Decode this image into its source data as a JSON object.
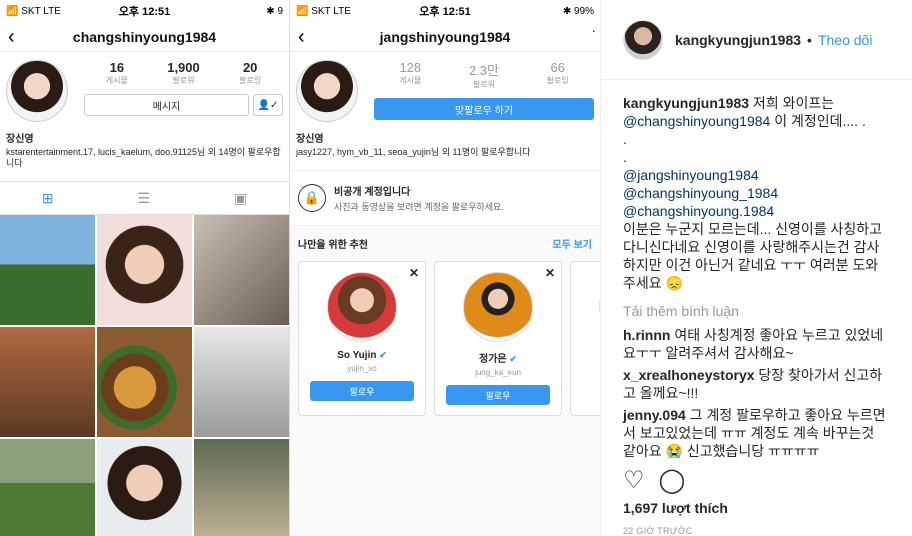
{
  "phone1": {
    "status": {
      "carrier": "📶 SKT  LTE",
      "time": "오후 12:51",
      "battery": "✱ 9"
    },
    "username": "changshinyoung1984",
    "stats": [
      {
        "num": "16",
        "label": "게시물"
      },
      {
        "num": "1,900",
        "label": "팔로워"
      },
      {
        "num": "20",
        "label": "팔로잉"
      }
    ],
    "message_btn": "메시지",
    "name": "장신영",
    "followed_by": "kstarentertainment.17, lucis_kaelum, doo.91125님 외 14명이 팔로우합니다"
  },
  "phone2": {
    "status": {
      "carrier": "📶 SKT  LTE",
      "time": "오후 12:51",
      "battery": "✱ 99%"
    },
    "username": "jangshinyoung1984",
    "stats": [
      {
        "num": "128",
        "label": "게시물"
      },
      {
        "num": "2.3만",
        "label": "팔로워"
      },
      {
        "num": "66",
        "label": "팔로잉"
      }
    ],
    "follow_back_btn": "맞팔로우 하기",
    "name": "장신영",
    "followed_by": "jasy1227, hym_vb_11, seoa_yujin님 외 11명이 팔로우합니다",
    "private_title": "비공개 계정입니다",
    "private_sub": "사진과 동영상을 보려면 계정을 팔로우하세요.",
    "suggest_title": "나만을 위한 추천",
    "suggest_all": "모두 보기",
    "suggestions": [
      {
        "name": "So Yujin",
        "handle": "yujin_so",
        "button": "팔로우"
      },
      {
        "name": "정가은",
        "handle": "jung_ka_eun",
        "button": "팔로우"
      }
    ]
  },
  "side": {
    "username": "kangkyungjun1983",
    "separator": "•",
    "follow": "Theo dõi",
    "caption_user": "kangkyungjun1983",
    "caption_line1": " 저희 와이프는",
    "caption_mention": "@changshinyoung1984",
    "caption_line2": " 이 계정인데.... .",
    "dot1": ".",
    "dot2": ".",
    "mention1": "@jangshinyoung1984",
    "mention2": "@changshinyoung_1984",
    "mention3": "@changshinyoung.1984",
    "caption_tail": "이분은 누군지 모르는데... 신영이를 사칭하고 다니신다네요 신영이를 사랑해주시는건 감사하지만 이건 아닌거 같네요 ㅜㅜ 여러분 도와주세요 😞",
    "load_more": "Tải thêm bình luận",
    "comments": [
      {
        "user": "h.rinnn",
        "text": " 여태 사칭계정 좋아요 누르고 있었네요ㅜㅜ 알려주셔서 감사해요~"
      },
      {
        "user": "x_xrealhoneystoryx",
        "text": " 당장 찾아가서 신고하고 올께요~!!!"
      },
      {
        "user": "jenny.094",
        "text": " 그 계정 팔로우하고 좋아요 누르면서 보고있었는데 ㅠㅠ 계정도 계속 바꾸는것 같아요 😭 신고했습니당 ㅠㅠㅠㅠ"
      }
    ],
    "likes": "1,697 lượt thích",
    "time_ago": "22 GIỜ TRƯỚC"
  }
}
